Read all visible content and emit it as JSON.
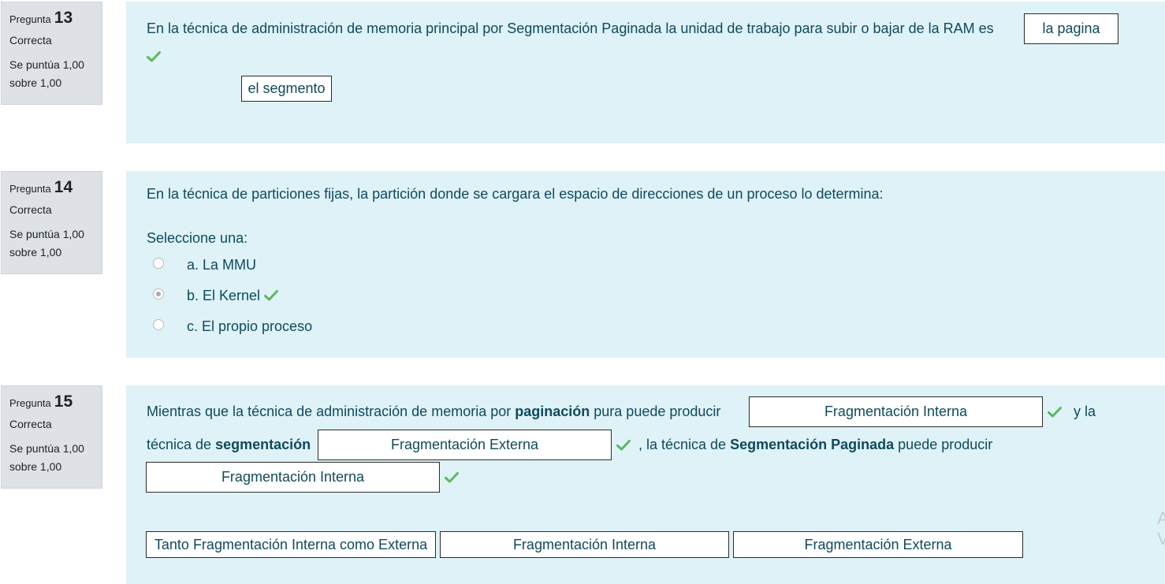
{
  "questions": [
    {
      "label": "Pregunta",
      "number": "13",
      "state": "Correcta",
      "grade_line1": "Se puntúa 1,00",
      "grade_line2": "sobre 1,00",
      "text": "En la técnica de administración de memoria principal por Segmentación Paginada la unidad de trabajo para subir o bajar de la RAM es",
      "answer": "la pagina",
      "choices": [
        "el segmento"
      ]
    },
    {
      "label": "Pregunta",
      "number": "14",
      "state": "Correcta",
      "grade_line1": "Se puntúa 1,00",
      "grade_line2": "sobre 1,00",
      "text": "En la técnica de particiones fijas, la partición donde se cargara el espacio de direcciones de un proceso lo determina:",
      "prompt": "Seleccione una:",
      "options": [
        {
          "label": "a. La MMU",
          "selected": false
        },
        {
          "label": "b. El Kernel",
          "selected": true
        },
        {
          "label": "c. El propio proceso",
          "selected": false
        }
      ]
    },
    {
      "label": "Pregunta",
      "number": "15",
      "state": "Correcta",
      "grade_line1": "Se puntúa 1,00",
      "grade_line2": "sobre 1,00",
      "text_part1": "Mientras que la técnica de administración de memoria por",
      "bold1": "paginación",
      "text_part2": "pura puede producir",
      "answer1": "Fragmentación Interna",
      "text_part3": "y la",
      "text_part4": "técnica de",
      "bold2": "segmentación",
      "answer2": "Fragmentación Externa",
      "text_part5": ", la técnica de",
      "bold3": "Segmentación Paginada",
      "text_part6": "puede producir",
      "answer3": "Fragmentación Interna",
      "choices": [
        "Tanto Fragmentación Interna como Externa",
        "Fragmentación Interna",
        "Fragmentación Externa"
      ]
    }
  ],
  "edge_text": [
    "A",
    "V"
  ],
  "colors": {
    "info_bg": "#dee2e6",
    "content_bg": "#def2f8",
    "text": "#0f4a5c",
    "check": "#5cb85c"
  },
  "icons": {
    "correct": "check-icon"
  }
}
